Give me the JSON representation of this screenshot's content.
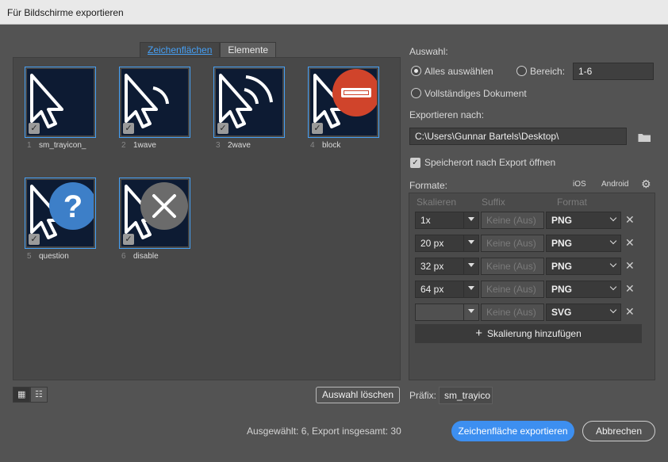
{
  "window": {
    "title": "Für Bildschirme exportieren"
  },
  "tabs": [
    "Zeichenflächen",
    "Elemente"
  ],
  "artboards": [
    {
      "num": "1",
      "name": "sm_trayicon_",
      "overlay": "none"
    },
    {
      "num": "2",
      "name": "1wave",
      "overlay": "wave1"
    },
    {
      "num": "3",
      "name": "2wave",
      "overlay": "wave2"
    },
    {
      "num": "4",
      "name": "block",
      "overlay": "block"
    },
    {
      "num": "5",
      "name": "question",
      "overlay": "question"
    },
    {
      "num": "6",
      "name": "disable",
      "overlay": "disable"
    }
  ],
  "icons": {
    "cursor": "arrow-cursor-icon",
    "check": "checkmark-icon",
    "folder": "folder-icon",
    "gear": "gear-icon",
    "close": "close-icon",
    "grid": "grid-view-icon",
    "list": "list-view-icon"
  },
  "selection": {
    "heading": "Auswahl:",
    "all": "Alles auswählen",
    "range_label": "Bereich:",
    "range_value": "1-6",
    "full_doc": "Vollständiges Dokument"
  },
  "export_to": {
    "heading": "Exportieren nach:",
    "path": "C:\\Users\\Gunnar Bartels\\Desktop\\",
    "open_after": "Speicherort nach Export öffnen"
  },
  "formats": {
    "heading": "Formate:",
    "ios": "iOS",
    "android": "Android",
    "columns": {
      "scale": "Skalieren",
      "suffix": "Suffix",
      "format": "Format"
    },
    "rows": [
      {
        "scale": "1x",
        "suffix": "Keine (Aus)",
        "format": "PNG",
        "dim": false
      },
      {
        "scale": "20 px",
        "suffix": "Keine (Aus)",
        "format": "PNG",
        "dim": false
      },
      {
        "scale": "32 px",
        "suffix": "Keine (Aus)",
        "format": "PNG",
        "dim": false
      },
      {
        "scale": "64 px",
        "suffix": "Keine (Aus)",
        "format": "PNG",
        "dim": false
      },
      {
        "scale": "",
        "suffix": "Keine (Aus)",
        "format": "SVG",
        "dim": true
      }
    ],
    "add_scale": "Skalierung hinzufügen"
  },
  "prefix": {
    "label": "Präfix:",
    "value": "sm_trayico"
  },
  "buttons": {
    "clear": "Auswahl löschen",
    "export": "Zeichenfläche exportieren",
    "cancel": "Abbrechen"
  },
  "status": "Ausgewählt: 6, Export insgesamt: 30",
  "colors": {
    "accent": "#3d8ff0",
    "artboard_bg": "#0d1b33",
    "block_red": "#d0442b",
    "question_blue": "#3d7fc8",
    "disable_gray": "#6b6b6b"
  }
}
